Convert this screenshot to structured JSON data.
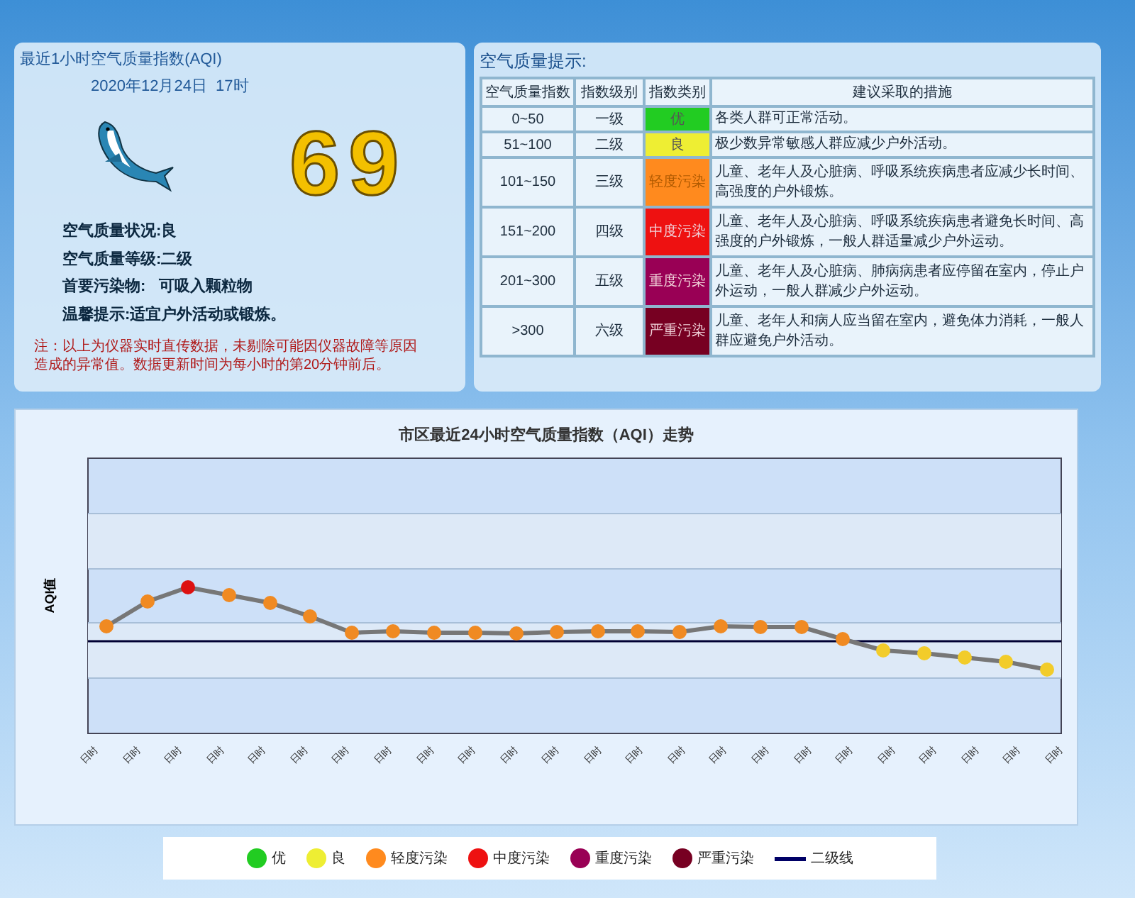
{
  "aqi_panel": {
    "title": "最近1小时空气质量指数(AQI)",
    "timestamp": "2020年12月24日  17时",
    "aqi_value": "69",
    "details": [
      {
        "label": "空气质量状况:",
        "value": "良"
      },
      {
        "label": "空气质量等级:",
        "value": "二级"
      },
      {
        "label": "首要污染物:",
        "value": "可吸入颗粒物"
      },
      {
        "label": "温馨提示:",
        "value": "适宜户外活动或锻炼。"
      }
    ],
    "note": "注：以上为仪器实时直传数据，未剔除可能因仪器故障等原因造成的异常值。数据更新时间为每小时的第20分钟前后。"
  },
  "hints_panel": {
    "title": "空气质量提示:",
    "columns": [
      "空气质量指数",
      "指数级别",
      "指数类别",
      "建议采取的措施"
    ],
    "rows": [
      {
        "range": "0~50",
        "level": "一级",
        "category": "优",
        "color": "#22cc22",
        "advice": "各类人群可正常活动。"
      },
      {
        "range": "51~100",
        "level": "二级",
        "category": "良",
        "color": "#eeee33",
        "advice": "极少数异常敏感人群应减少户外活动。"
      },
      {
        "range": "101~150",
        "level": "三级",
        "category": "轻度污染",
        "color": "#ff8a1e",
        "advice": "儿童、老年人及心脏病、呼吸系统疾病患者应减少长时间、高强度的户外锻炼。"
      },
      {
        "range": "151~200",
        "level": "四级",
        "category": "中度污染",
        "color": "#ee1111",
        "advice": "儿童、老年人及心脏病、呼吸系统疾病患者避免长时间、高强度的户外锻炼，一般人群适量减少户外运动。"
      },
      {
        "range": "201~300",
        "level": "五级",
        "category": "重度污染",
        "color": "#990055",
        "advice": "儿童、老年人及心脏病、肺病病患者应停留在室内，停止户外运动，一般人群减少户外运动。"
      },
      {
        "range": ">300",
        "level": "六级",
        "category": "严重污染",
        "color": "#770022",
        "advice": "儿童、老年人和病人应当留在室内，避免体力消耗，一般人群应避免户外活动。"
      }
    ]
  },
  "chart": {
    "title": "市区最近24小时空气质量指数（AQI）走势",
    "ylabel": "AQI值",
    "x_labels": [
      "日时",
      "日时",
      "日时",
      "日时",
      "日时",
      "日时",
      "日时",
      "日时",
      "日时",
      "日时",
      "日时",
      "日时",
      "日时",
      "日时",
      "日时",
      "日时",
      "日时",
      "日时",
      "日时",
      "日时",
      "日时",
      "日时",
      "日时",
      "日时"
    ]
  },
  "legend": [
    {
      "kind": "dot",
      "label": "优",
      "color": "#22cc22"
    },
    {
      "kind": "dot",
      "label": "良",
      "color": "#eeee33"
    },
    {
      "kind": "dot",
      "label": "轻度污染",
      "color": "#ff8a1e"
    },
    {
      "kind": "dot",
      "label": "中度污染",
      "color": "#ee1111"
    },
    {
      "kind": "dot",
      "label": "重度污染",
      "color": "#990055"
    },
    {
      "kind": "dot",
      "label": "严重污染",
      "color": "#770022"
    },
    {
      "kind": "line",
      "label": "二级线",
      "color": "#000066"
    }
  ]
}
